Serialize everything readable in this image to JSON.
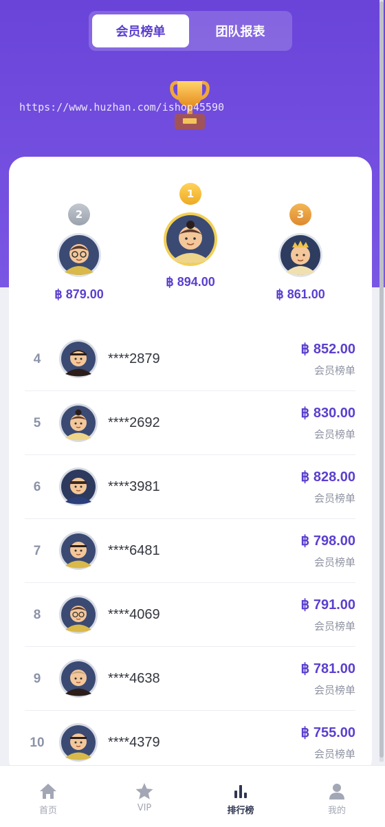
{
  "tabs": [
    {
      "label": "会员榜单",
      "active": true
    },
    {
      "label": "团队报表",
      "active": false
    }
  ],
  "watermark": "https://www.huzhan.com/ishop45590",
  "currency": "฿",
  "podium": [
    {
      "rank": "2",
      "amount": "฿ 879.00"
    },
    {
      "rank": "1",
      "amount": "฿ 894.00"
    },
    {
      "rank": "3",
      "amount": "฿ 861.00"
    }
  ],
  "ranks": [
    {
      "rank": "4",
      "user": "****2879",
      "amount": "฿ 852.00",
      "label": "会员榜单"
    },
    {
      "rank": "5",
      "user": "****2692",
      "amount": "฿ 830.00",
      "label": "会员榜单"
    },
    {
      "rank": "6",
      "user": "****3981",
      "amount": "฿ 828.00",
      "label": "会员榜单"
    },
    {
      "rank": "7",
      "user": "****6481",
      "amount": "฿ 798.00",
      "label": "会员榜单"
    },
    {
      "rank": "8",
      "user": "****4069",
      "amount": "฿ 791.00",
      "label": "会员榜单"
    },
    {
      "rank": "9",
      "user": "****4638",
      "amount": "฿ 781.00",
      "label": "会员榜单"
    },
    {
      "rank": "10",
      "user": "****4379",
      "amount": "฿ 755.00",
      "label": "会员榜单"
    }
  ],
  "tabbar": [
    {
      "label": "首页",
      "icon": "home-icon",
      "active": false
    },
    {
      "label": "VIP",
      "icon": "star-icon",
      "active": false
    },
    {
      "label": "排行榜",
      "icon": "bar-chart-icon",
      "active": true
    },
    {
      "label": "我的",
      "icon": "user-icon",
      "active": false
    }
  ],
  "colors": {
    "accent": "#5b3fcf",
    "gold": "#f1b730",
    "silver": "#a9b0bb",
    "bronze": "#e8a03c"
  }
}
